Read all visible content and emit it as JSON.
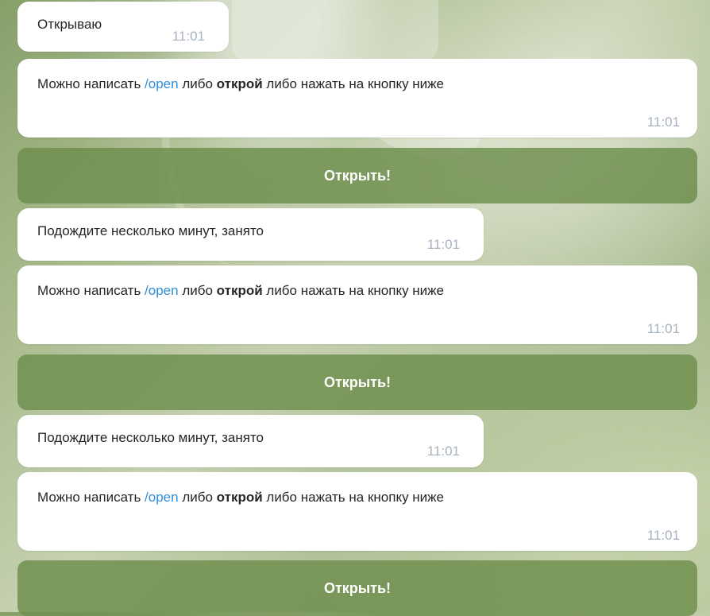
{
  "messages": [
    {
      "text": "Открываю",
      "time": "11:01"
    },
    {
      "text_before": "Можно написать ",
      "command": "/open",
      "text_middle": " либо ",
      "bold": "открой",
      "text_after": " либо нажать на кнопку ниже",
      "time": "11:01"
    },
    {
      "button_label": "Открыть!"
    },
    {
      "text": "Подождите несколько минут, занято",
      "time": "11:01"
    },
    {
      "text_before": "Можно написать ",
      "command": "/open",
      "text_middle": " либо ",
      "bold": "открой",
      "text_after": " либо нажать на кнопку ниже",
      "time": "11:01"
    },
    {
      "button_label": "Открыть!"
    },
    {
      "text": "Подождите несколько минут, занято",
      "time": "11:01"
    },
    {
      "text_before": "Можно написать ",
      "command": "/open",
      "text_middle": " либо ",
      "bold": "открой",
      "text_after": " либо нажать на кнопку ниже",
      "time": "11:01"
    },
    {
      "button_label": "Открыть!"
    }
  ],
  "colors": {
    "background": "#a8ba8c",
    "bubble": "#ffffff",
    "text": "#262626",
    "command": "#2f8fd8",
    "time": "#a6b2be",
    "button": "#6c8e4c",
    "button_text": "#ffffff"
  }
}
